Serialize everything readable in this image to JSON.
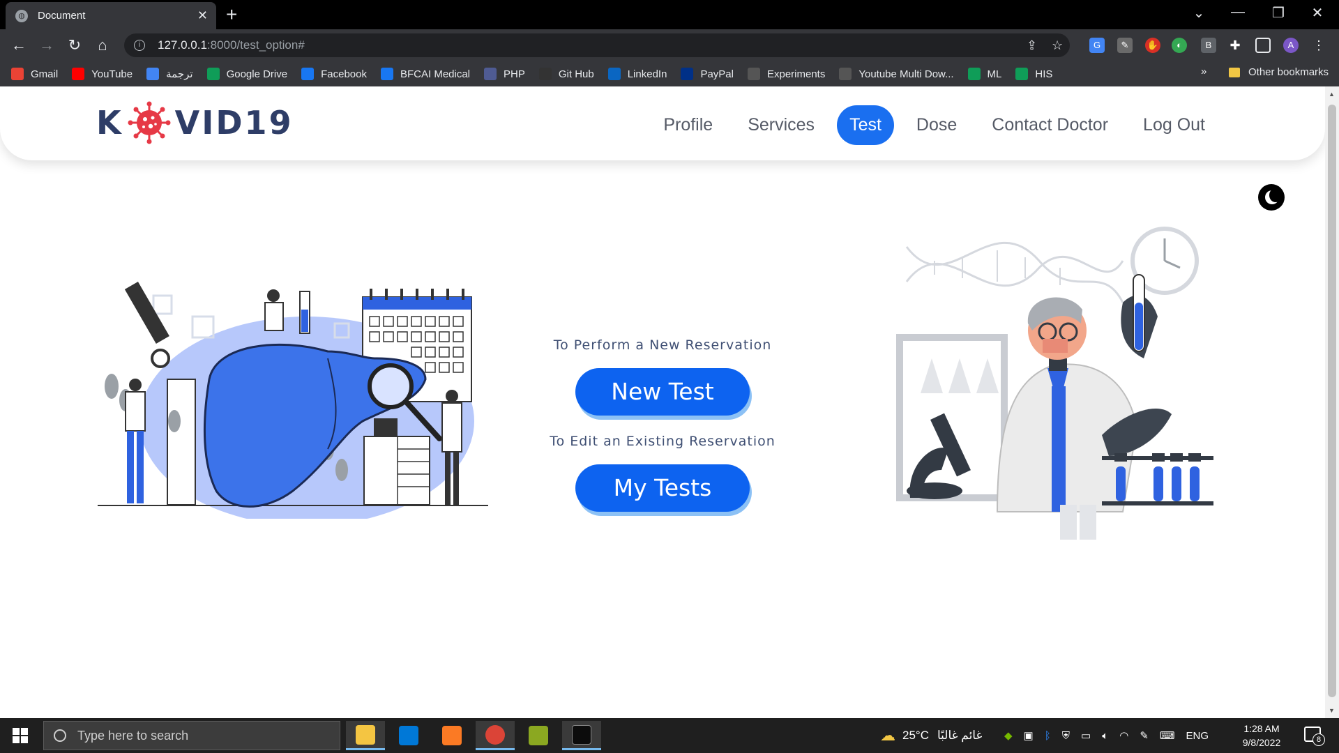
{
  "browser": {
    "tab_title": "Document",
    "url_host": "127.0.0.1",
    "url_path": ":8000/test_option#",
    "bookmarks": [
      {
        "label": "Gmail",
        "icon": "gmail-icon",
        "color": "#ea4335"
      },
      {
        "label": "YouTube",
        "icon": "youtube-icon",
        "color": "#ff0000"
      },
      {
        "label": "ترجمة",
        "icon": "translate-icon",
        "color": "#4285f4"
      },
      {
        "label": "Google Drive",
        "icon": "drive-icon",
        "color": "#0f9d58"
      },
      {
        "label": "Facebook",
        "icon": "facebook-icon",
        "color": "#1877f2"
      },
      {
        "label": "BFCAI Medical",
        "icon": "facebook-icon",
        "color": "#1877f2"
      },
      {
        "label": "PHP",
        "icon": "php-icon",
        "color": "#4f5b93"
      },
      {
        "label": "Git Hub",
        "icon": "github-icon",
        "color": "#333333"
      },
      {
        "label": "LinkedIn",
        "icon": "linkedin-icon",
        "color": "#0a66c2"
      },
      {
        "label": "PayPal",
        "icon": "paypal-icon",
        "color": "#003087"
      },
      {
        "label": "Experiments",
        "icon": "flask-icon",
        "color": "#555555"
      },
      {
        "label": "Youtube Multi Dow...",
        "icon": "globe-icon",
        "color": "#555555"
      },
      {
        "label": "ML",
        "icon": "drive-icon",
        "color": "#0f9d58"
      },
      {
        "label": "HIS",
        "icon": "drive-icon",
        "color": "#0f9d58"
      }
    ],
    "more_bookmarks": "»",
    "other_bookmarks": "Other bookmarks",
    "profile_initial": "A"
  },
  "site": {
    "logo_left": "K",
    "logo_right": "VID19",
    "nav": [
      {
        "label": "Profile",
        "active": false
      },
      {
        "label": "Services",
        "active": false
      },
      {
        "label": "Test",
        "active": true
      },
      {
        "label": "Dose",
        "active": false
      },
      {
        "label": "Contact Doctor",
        "active": false
      },
      {
        "label": "Log Out",
        "active": false
      }
    ],
    "new_caption": "To Perform a New Reservation",
    "new_button": "New Test",
    "edit_caption": "To Edit an Existing Reservation",
    "edit_button": "My Tests",
    "accent_color": "#1a6ff0",
    "logo_color": "#2e3d67"
  },
  "taskbar": {
    "search_placeholder": "Type here to search",
    "weather_temp": "25°C",
    "weather_text": "غائم غالبًا",
    "language": "ENG",
    "time": "1:28 AM",
    "date": "9/8/2022",
    "notification_count": "8"
  }
}
